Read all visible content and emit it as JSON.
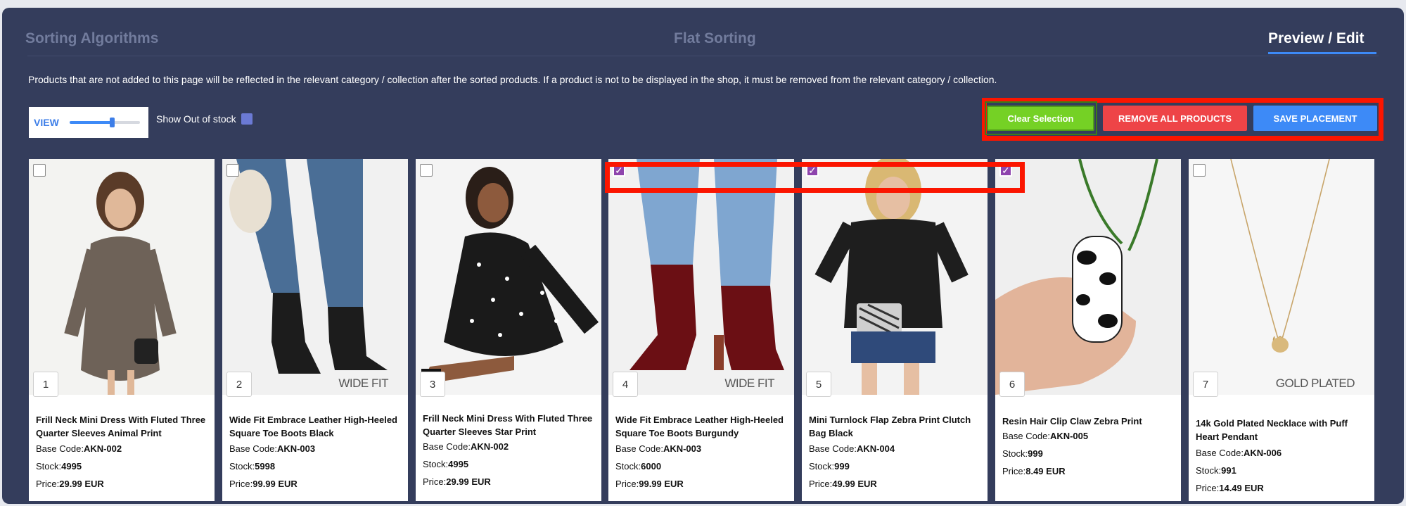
{
  "tabs": [
    {
      "label": "Sorting Algorithms"
    },
    {
      "label": "Flat Sorting"
    },
    {
      "label": "Preview / Edit"
    }
  ],
  "notice": "Products that are not added to this page will be reflected in the relevant category / collection after the sorted products. If a product is not to be displayed in the shop, it must be removed from the relevant category / collection.",
  "view": {
    "label": "VIEW",
    "slider_value": 0.6
  },
  "show_out_of_stock": {
    "label": "Show Out of stock",
    "checked": true
  },
  "actions": {
    "clear": "Clear Selection",
    "remove_all": "REMOVE ALL PRODUCTS",
    "save": "SAVE PLACEMENT"
  },
  "labels": {
    "base_code": "Base Code:",
    "stock": "Stock:",
    "price": "Price:"
  },
  "colors": {
    "accent": "#3d8af7",
    "clear": "#75d125",
    "remove": "#ee4447",
    "selected": "#8e44ad",
    "highlight": "#fb1500"
  },
  "products": [
    {
      "num": "1",
      "title": "Frill Neck Mini Dress With Fluted Three Quarter Sleeves Animal Print",
      "base_code": "AKN-002",
      "stock": "4995",
      "price": "29.99 EUR",
      "selected": false,
      "badge": ""
    },
    {
      "num": "2",
      "title": "Wide Fit Embrace Leather High-Heeled Square Toe Boots Black",
      "base_code": "AKN-003",
      "stock": "5998",
      "price": "99.99 EUR",
      "selected": false,
      "badge": "WIDE FIT"
    },
    {
      "num": "3",
      "title": "Frill Neck Mini Dress With Fluted Three Quarter Sleeves Star Print",
      "base_code": "AKN-002",
      "stock": "4995",
      "price": "29.99 EUR",
      "selected": false,
      "badge": ""
    },
    {
      "num": "4",
      "title": "Wide Fit Embrace Leather High-Heeled Square Toe Boots Burgundy",
      "base_code": "AKN-003",
      "stock": "6000",
      "price": "99.99 EUR",
      "selected": true,
      "badge": "WIDE FIT"
    },
    {
      "num": "5",
      "title": "Mini Turnlock Flap Zebra Print Clutch Bag Black",
      "base_code": "AKN-004",
      "stock": "999",
      "price": "49.99 EUR",
      "selected": true,
      "badge": ""
    },
    {
      "num": "6",
      "title": "Resin Hair Clip Claw Zebra Print",
      "base_code": "AKN-005",
      "stock": "999",
      "price": "8.49 EUR",
      "selected": true,
      "badge": ""
    },
    {
      "num": "7",
      "title": "14k Gold Plated Necklace with Puff Heart Pendant",
      "base_code": "AKN-006",
      "stock": "991",
      "price": "14.49 EUR",
      "selected": false,
      "badge": "GOLD PLATED"
    }
  ]
}
